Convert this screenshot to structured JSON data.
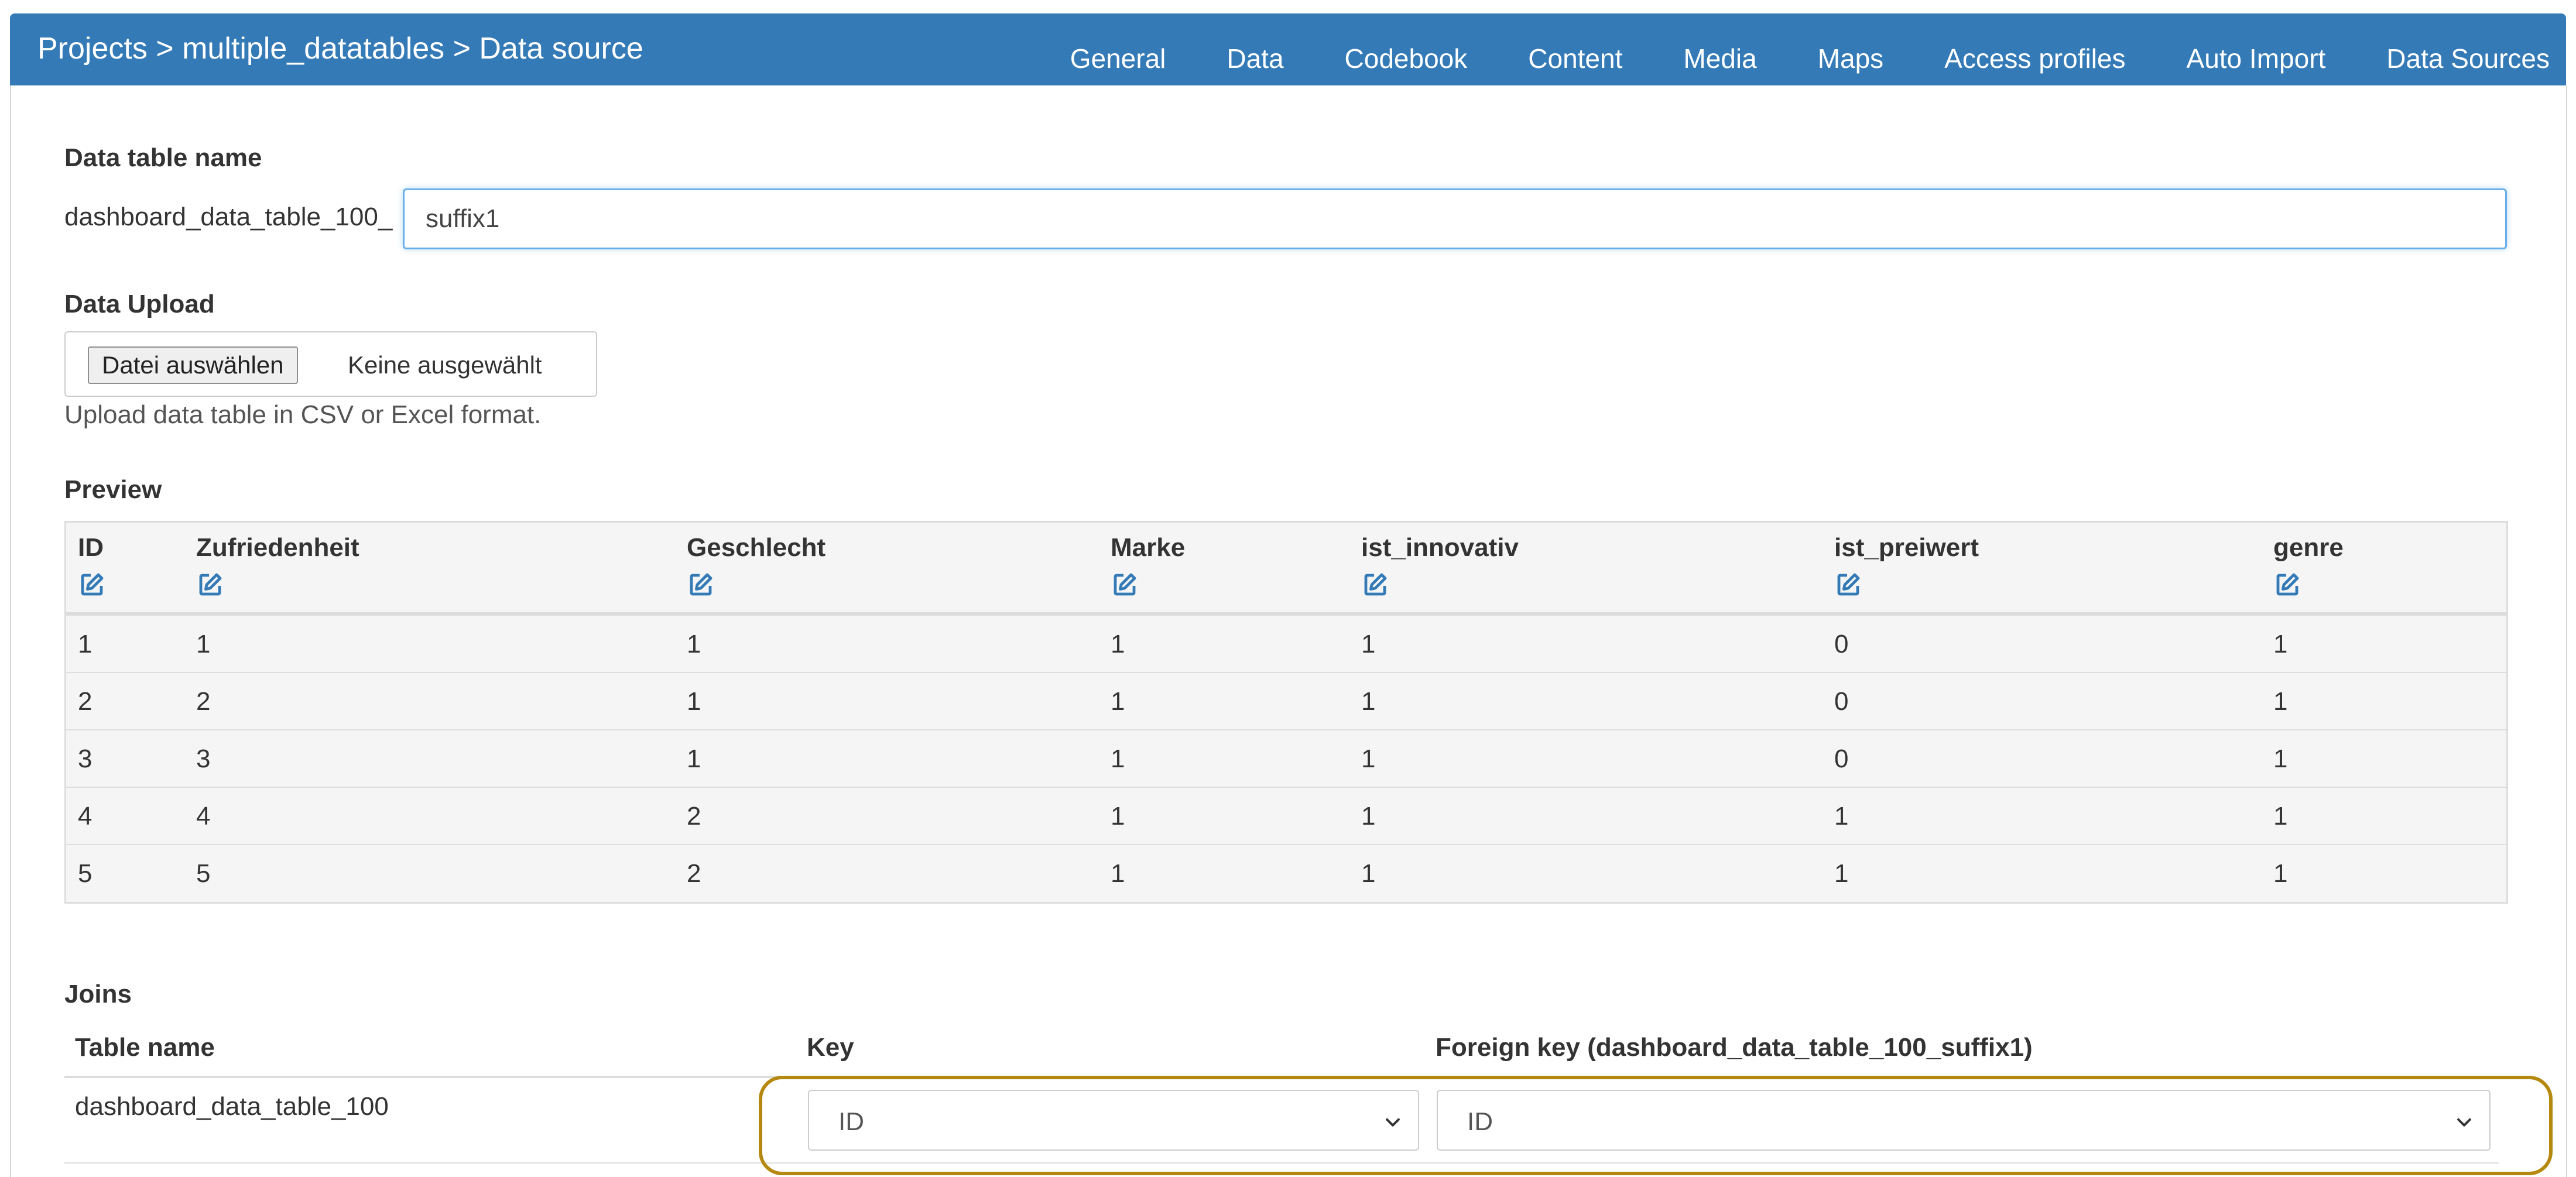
{
  "header": {
    "breadcrumb": "Projects > multiple_datatables > Data source",
    "nav": [
      "General",
      "Data",
      "Codebook",
      "Content",
      "Media",
      "Maps",
      "Access profiles",
      "Auto Import",
      "Data Sources"
    ]
  },
  "table_name": {
    "label": "Data table name",
    "prefix": "dashboard_data_table_100_",
    "value": "suffix1"
  },
  "upload": {
    "label": "Data Upload",
    "button": "Datei auswählen",
    "status": "Keine ausgewählt",
    "help": "Upload data table in CSV or Excel format."
  },
  "preview": {
    "label": "Preview",
    "columns": [
      "ID",
      "Zufriedenheit",
      "Geschlecht",
      "Marke",
      "ist_innovativ",
      "ist_preiwert",
      "genre"
    ],
    "rows": [
      [
        "1",
        "1",
        "1",
        "1",
        "1",
        "0",
        "1"
      ],
      [
        "2",
        "2",
        "1",
        "1",
        "1",
        "0",
        "1"
      ],
      [
        "3",
        "3",
        "1",
        "1",
        "1",
        "0",
        "1"
      ],
      [
        "4",
        "4",
        "2",
        "1",
        "1",
        "1",
        "1"
      ],
      [
        "5",
        "5",
        "2",
        "1",
        "1",
        "1",
        "1"
      ]
    ]
  },
  "joins": {
    "label": "Joins",
    "headers": {
      "table_name": "Table name",
      "key": "Key",
      "foreign_key": "Foreign key (dashboard_data_table_100_suffix1)"
    },
    "row": {
      "table_name": "dashboard_data_table_100",
      "key": "ID",
      "foreign_key": "ID"
    }
  },
  "colors": {
    "header_bg": "#337ab7",
    "accent": "#337ab7",
    "highlight": "#b5890f"
  },
  "icons": {
    "column_edit": "edit-icon",
    "select_caret": "chevron-down-icon"
  }
}
